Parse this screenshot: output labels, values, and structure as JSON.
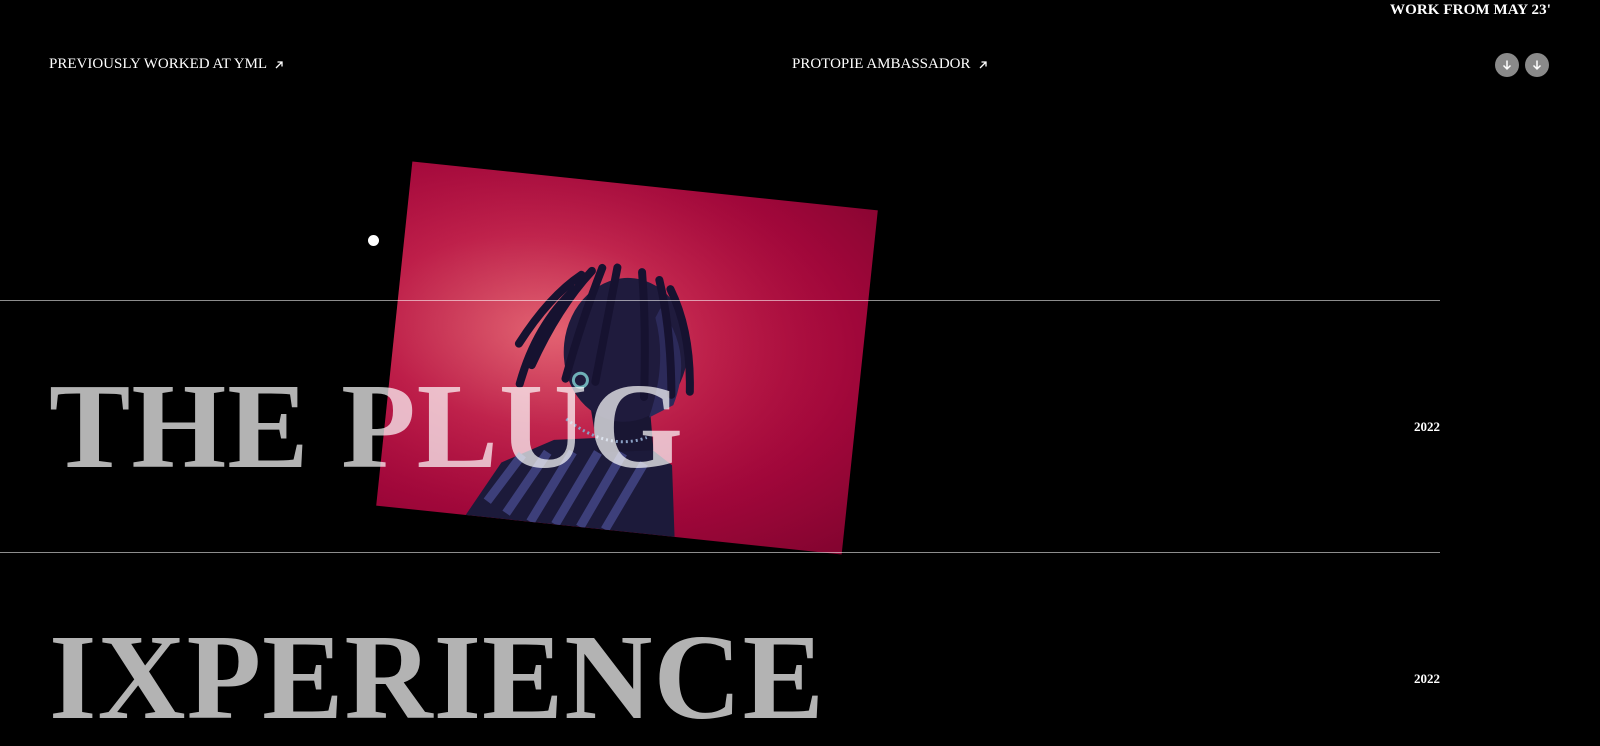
{
  "header": {
    "availability": "WORK FROM MAY 23'",
    "links": [
      {
        "label": "PREVIOUSLY WORKED AT YML",
        "icon": "arrow-up-right-icon"
      },
      {
        "label": "PROTOPIE AMBASSADOR",
        "icon": "arrow-up-right-icon"
      }
    ],
    "scroll_buttons": [
      {
        "icon": "arrow-down-icon"
      },
      {
        "icon": "arrow-down-icon"
      }
    ]
  },
  "projects": [
    {
      "title": "THE PLUG",
      "year": "2022"
    },
    {
      "title": "IXPERIENCE",
      "year": "2022"
    }
  ],
  "colors": {
    "background": "#000000",
    "title": "#b3b3b3",
    "divider": "#8d8d8d",
    "button": "#8a8a8a",
    "image_accent": "#c21a48"
  }
}
